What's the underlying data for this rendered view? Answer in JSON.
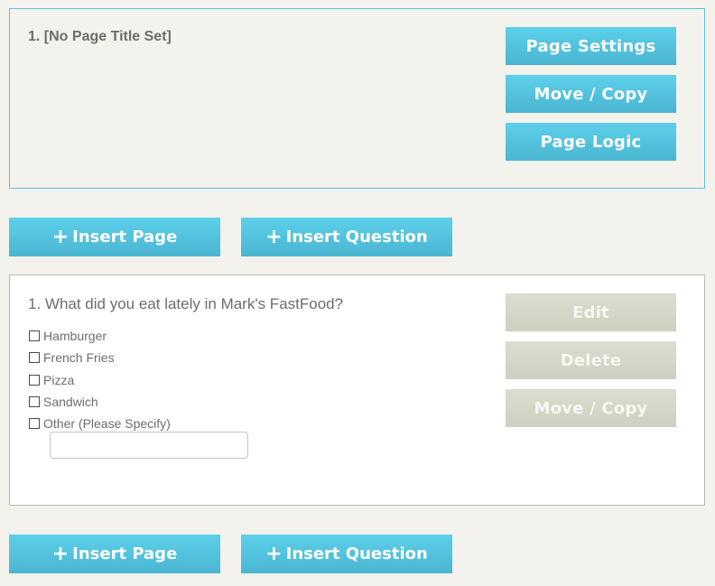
{
  "page_panel": {
    "title": "1. [No Page Title Set]",
    "buttons": {
      "page_settings": "Page Settings",
      "move_copy": "Move / Copy",
      "page_logic": "Page Logic"
    }
  },
  "actions": {
    "plus_glyph": "+",
    "insert_page": "Insert Page",
    "insert_question": "Insert Question"
  },
  "question": {
    "text": "1. What did you eat lately in Mark's FastFood?",
    "options": [
      "Hamburger",
      "French Fries",
      "Pizza",
      "Sandwich",
      "Other (Please Specify)"
    ],
    "other_value": "",
    "buttons": {
      "edit": "Edit",
      "delete": "Delete",
      "move_copy": "Move / Copy"
    }
  },
  "colors": {
    "accent": "#4ec3e0",
    "panel_border": "#5bc3dc",
    "disabled_button": "#d5d5c8",
    "background": "#f3f2ec"
  }
}
